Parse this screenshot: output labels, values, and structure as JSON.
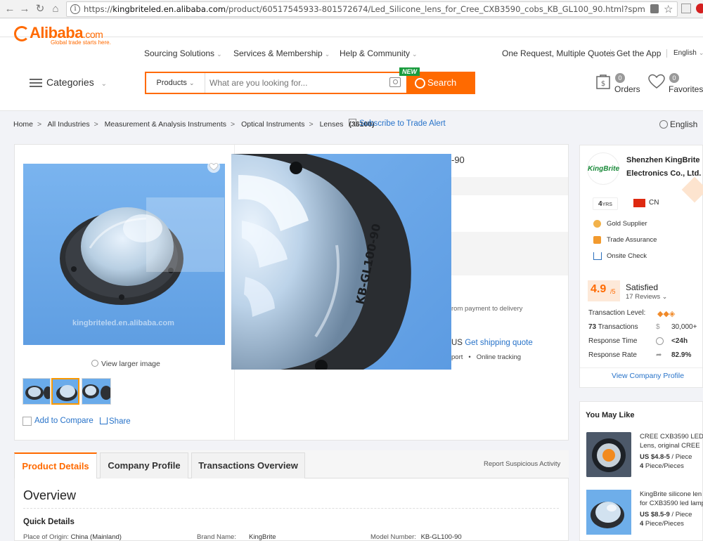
{
  "browser": {
    "url_prefix": "https://",
    "url_host": "kingbriteled.en.alibaba.com",
    "url_path": "/product/60517545933-801572674/Led_Silicone_lens_for_Cree_CXB3590_cobs_KB_GL100_90.html?spm=a2700.8304367.p..."
  },
  "header": {
    "logo_text": "Alibaba",
    "logo_suffix": ".com",
    "logo_tagline": "Global trade starts here.",
    "nav": [
      "Sourcing Solutions",
      "Services & Membership",
      "Help & Community"
    ],
    "right_links": [
      "One Request, Multiple Quotes",
      "Get the App"
    ],
    "language": "English",
    "categories_label": "Categories",
    "search": {
      "category": "Products",
      "placeholder": "What are you looking for...",
      "button": "Search",
      "new_badge": "NEW"
    },
    "orders": {
      "label": "Orders",
      "count": "0"
    },
    "favorites": {
      "label": "Favorites",
      "count": "0"
    }
  },
  "breadcrumb": {
    "items": [
      "Home",
      "All Industries",
      "Measurement & Analysis Instruments",
      "Optical Instruments",
      "Lenses"
    ],
    "count": "(36100)",
    "subscribe": "Subscribe to Trade Alert",
    "language": "English"
  },
  "product": {
    "title_fragment": "-90",
    "image_watermark": "kingbriteled.en.alibaba.com",
    "lens_marking": "KB-GL100-90",
    "view_larger": "View larger image",
    "add_compare": "Add to Compare",
    "share": "Share",
    "payment_text": "rom payment to delivery",
    "shipping_prefix": "US",
    "shipping_link": "Get shipping quote",
    "tracking_fragment": "port",
    "tracking": "Online tracking"
  },
  "supplier": {
    "logo_text": "KingBrite",
    "name_line1": "Shenzhen KingBrite",
    "name_line2": "Electronics Co., Ltd.",
    "years": "4",
    "years_unit": "YRS",
    "country": "CN",
    "badges": [
      "Gold Supplier",
      "Trade Assurance",
      "Onsite Check"
    ],
    "rating": "4.9",
    "rating_max": "/5",
    "rating_word": "Satisfied",
    "reviews": "17 Reviews",
    "stats": [
      {
        "label": "Transaction Level:",
        "value": ""
      },
      {
        "label": "Transactions",
        "prefix": "73",
        "value": "30,000+"
      },
      {
        "label": "Response Time",
        "value": "<24h"
      },
      {
        "label": "Response Rate",
        "value": "82.9%"
      }
    ],
    "view_profile": "View Company Profile"
  },
  "you_may_like": {
    "title": "You May Like",
    "items": [
      {
        "name_line1": "CREE CXB3590 LED",
        "name_line2": "Lens, original CREE",
        "price": "US $4.8-5",
        "unit": " / Piece",
        "moq": "4",
        "moq_unit": " Piece/Pieces"
      },
      {
        "name_line1": "KingBrite silicone len",
        "name_line2": "for CXB3590 led lamp",
        "price": "US $8.5-9",
        "unit": " / Piece",
        "moq": "4",
        "moq_unit": " Piece/Pieces"
      }
    ]
  },
  "tabs": {
    "items": [
      "Product Details",
      "Company Profile",
      "Transactions Overview"
    ],
    "report": "Report Suspicious Activity"
  },
  "overview": {
    "title": "Overview",
    "quick_details": "Quick Details",
    "fields": [
      {
        "label": "Place of Origin:",
        "value": "China (Mainland)"
      },
      {
        "label": "Brand Name:",
        "value": "KingBrite"
      },
      {
        "label": "Model Number:",
        "value": "KB-GL100-90"
      }
    ]
  }
}
